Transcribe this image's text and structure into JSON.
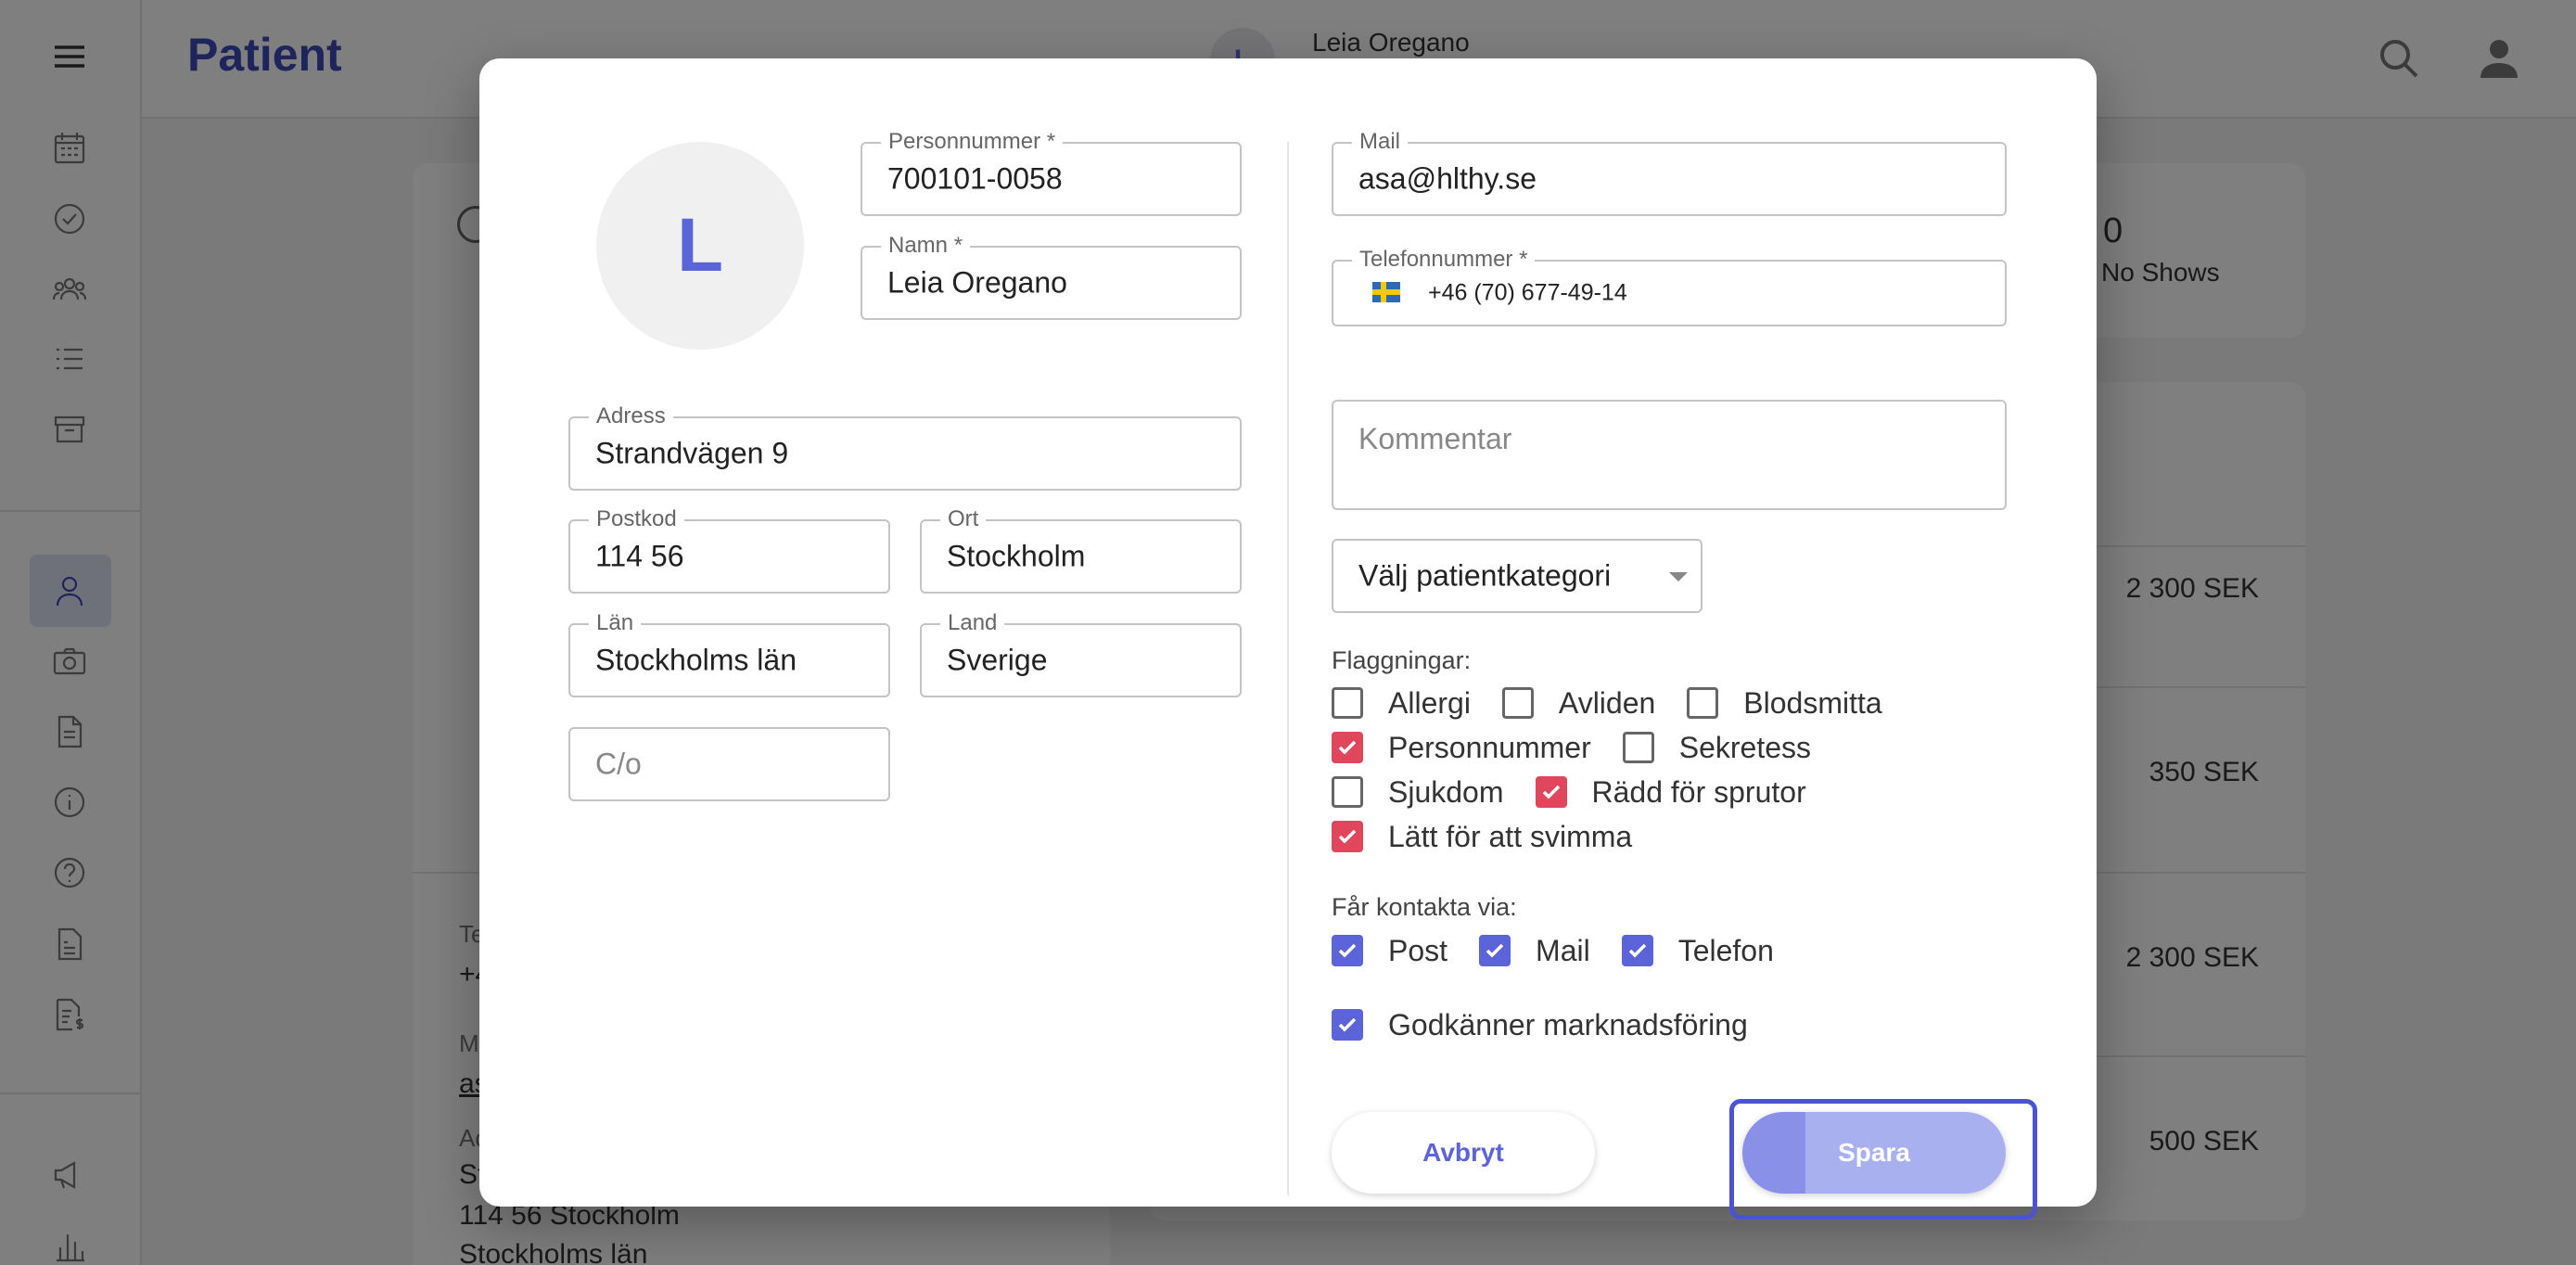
{
  "app": {
    "title": "Patient",
    "user_name": "Leia Oregano",
    "user_initial": "L"
  },
  "stats": {
    "no_shows_value": "0",
    "no_shows_label": "No Shows"
  },
  "prices": [
    "2 300 SEK",
    "350 SEK",
    "2 300 SEK",
    "500 SEK"
  ],
  "background_info": {
    "phone_label": "Te",
    "phone_value": "+4",
    "mail_label": "M",
    "mail_value": "as",
    "address_label": "Ad",
    "address_line1": "St",
    "address_line2": "114 56 Stockholm",
    "address_line3": "Stockholms län"
  },
  "dialog": {
    "avatar_initial": "L",
    "personnummer": {
      "label": "Personnummer *",
      "value": "700101-0058"
    },
    "namn": {
      "label": "Namn *",
      "value": "Leia Oregano"
    },
    "adress": {
      "label": "Adress",
      "value": "Strandvägen 9"
    },
    "postkod": {
      "label": "Postkod",
      "value": "114 56"
    },
    "ort": {
      "label": "Ort",
      "value": "Stockholm"
    },
    "lan": {
      "label": "Län",
      "value": "Stockholms län"
    },
    "land": {
      "label": "Land",
      "value": "Sverige"
    },
    "co": {
      "placeholder": "C/o"
    },
    "mail": {
      "label": "Mail",
      "value": "asa@hlthy.se"
    },
    "telefon": {
      "label": "Telefonnummer *",
      "value": "+46 (70) 677-49-14"
    },
    "kommentar": {
      "placeholder": "Kommentar"
    },
    "kategori": {
      "value": "Välj patientkategori"
    },
    "flags_label": "Flaggningar:",
    "flags": [
      {
        "label": "Allergi",
        "checked": false
      },
      {
        "label": "Avliden",
        "checked": false
      },
      {
        "label": "Blodsmitta",
        "checked": false
      },
      {
        "label": "Personnummer",
        "checked": true
      },
      {
        "label": "Sekretess",
        "checked": false
      },
      {
        "label": "Sjukdom",
        "checked": false
      },
      {
        "label": "Rädd för sprutor",
        "checked": true
      },
      {
        "label": "Lätt för att svimma",
        "checked": true
      }
    ],
    "contact_label": "Får kontakta via:",
    "contact": [
      {
        "label": "Post",
        "checked": true
      },
      {
        "label": "Mail",
        "checked": true
      },
      {
        "label": "Telefon",
        "checked": true
      }
    ],
    "marketing": {
      "label": "Godkänner marknadsföring",
      "checked": true
    },
    "cancel_label": "Avbryt",
    "save_label": "Spara"
  },
  "colors": {
    "accent": "#5b64d8",
    "title": "#3f4ab8",
    "flag_checked": "#e0475c",
    "save_button": "#a9b0f0"
  }
}
